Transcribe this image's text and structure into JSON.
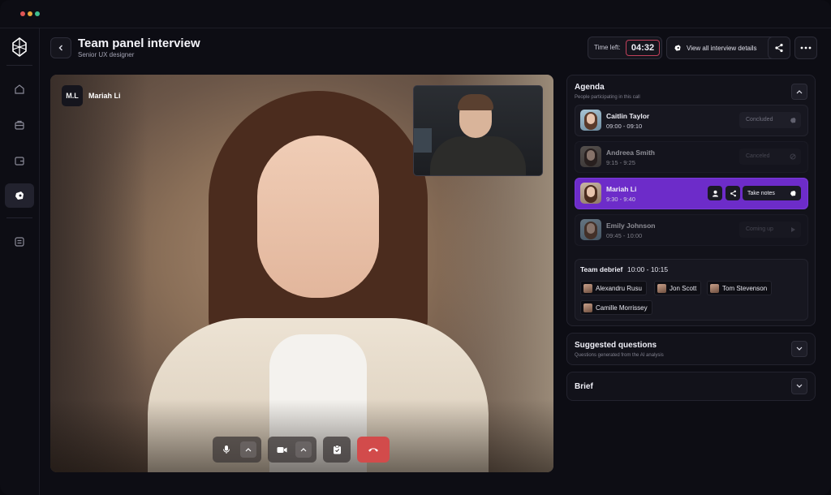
{
  "window": {
    "dots": [
      "#e05555",
      "#e8a53a",
      "#3fbf8f"
    ]
  },
  "sidebar": {
    "items": [
      {
        "icon": "home-icon",
        "active": false
      },
      {
        "icon": "briefcase-icon",
        "active": false
      },
      {
        "icon": "wallet-icon",
        "active": false
      },
      {
        "icon": "interview-icon",
        "active": true
      },
      {
        "icon": "settings-sliders-icon",
        "active": false
      }
    ]
  },
  "header": {
    "title": "Team panel interview",
    "subtitle": "Senior UX designer",
    "time_left_label": "Time left:",
    "time_left_value": "04:32",
    "details_label": "View all interview details"
  },
  "video": {
    "initials": "M.L",
    "participant_name": "Mariah Li"
  },
  "agenda": {
    "title": "Agenda",
    "subtitle": "People participating in this call",
    "rows": [
      {
        "name": "Caitlin Taylor",
        "time": "09:00 - 09:10",
        "status": "Concluded"
      },
      {
        "name": "Andreea Smith",
        "time": "9:15 - 9:25",
        "status": "Canceled"
      },
      {
        "name": "Mariah Li",
        "time": "9:30 - 9:40",
        "status": "Take notes"
      },
      {
        "name": "Emily Johnson",
        "time": "09:45 - 10:00",
        "status": "Coming up"
      }
    ],
    "debrief": {
      "title": "Team debrief",
      "time": "10:00 - 10:15",
      "people": [
        "Alexandru Rusu",
        "Jon Scott",
        "Tom Stevenson",
        "Camille Morrissey"
      ]
    }
  },
  "suggested": {
    "title": "Suggested questions",
    "subtitle": "Questions generated from the AI analysis"
  },
  "brief": {
    "title": "Brief"
  },
  "colors": {
    "accent": "#6d2cc9",
    "end_call": "#d24b4b",
    "timer_border": "#c0405a"
  }
}
